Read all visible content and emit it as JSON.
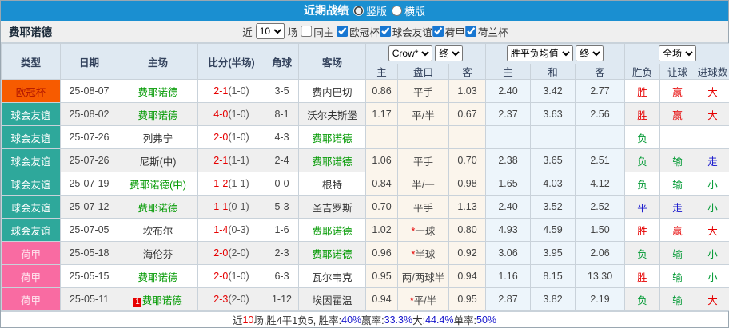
{
  "title_bar": {
    "title": "近期战绩",
    "vertical_label": "竖版",
    "horizontal_label": "横版"
  },
  "controls": {
    "team": "费耶诺德",
    "near_label": "近",
    "games_value": "10",
    "games_label": "场",
    "same_home_label": "同主",
    "league_filters": [
      "欧冠杯",
      "球会友谊",
      "荷甲",
      "荷兰杯"
    ]
  },
  "header": {
    "main_cols": [
      "类型",
      "日期",
      "主场",
      "比分(半场)",
      "角球",
      "客场"
    ],
    "asian_company_select": "Crow*",
    "asian_time_select": "终",
    "europe_company_select": "胜平负均值",
    "europe_time_select": "终",
    "scope_select": "全场",
    "asian_sub": [
      "主",
      "盘口",
      "客"
    ],
    "europe_sub": [
      "主",
      "和",
      "客"
    ],
    "result_sub": [
      "胜负",
      "让球",
      "进球数"
    ]
  },
  "league_colors": {
    "cl": "#f75b00",
    "friendly": "#2ea89b",
    "eredivisie": "#f96ba2"
  },
  "result_colors": {
    "red": "#e60000",
    "green": "#009933",
    "blue": "#1414cc"
  },
  "rows": [
    {
      "league": "欧冠杯",
      "league_type": "cl",
      "date": "25-08-07",
      "home": "费耶诺德",
      "home_highlight": true,
      "home_rank": "",
      "score": "2-1",
      "half": "(1-0)",
      "corners": "3-5",
      "away": "费内巴切",
      "away_highlight": false,
      "asian_home": "0.86",
      "handicap": "平手",
      "handicap_star": false,
      "asian_away": "1.03",
      "eu_home": "2.40",
      "eu_draw": "3.42",
      "eu_away": "2.77",
      "wdl": "胜",
      "wdl_color": "red",
      "hcp": "赢",
      "hcp_color": "red",
      "goal": "大",
      "goal_color": "red"
    },
    {
      "league": "球会友谊",
      "league_type": "friendly",
      "date": "25-08-02",
      "home": "费耶诺德",
      "home_highlight": true,
      "home_rank": "",
      "score": "4-0",
      "half": "(1-0)",
      "corners": "8-1",
      "away": "沃尔夫斯堡",
      "away_highlight": false,
      "asian_home": "1.17",
      "handicap": "平/半",
      "handicap_star": false,
      "asian_away": "0.67",
      "eu_home": "2.37",
      "eu_draw": "3.63",
      "eu_away": "2.56",
      "wdl": "胜",
      "wdl_color": "red",
      "hcp": "赢",
      "hcp_color": "red",
      "goal": "大",
      "goal_color": "red"
    },
    {
      "league": "球会友谊",
      "league_type": "friendly",
      "date": "25-07-26",
      "home": "列弗宁",
      "home_highlight": false,
      "home_rank": "",
      "score": "2-0",
      "half": "(1-0)",
      "corners": "4-3",
      "away": "费耶诺德",
      "away_highlight": true,
      "asian_home": "",
      "handicap": "",
      "handicap_star": false,
      "asian_away": "",
      "eu_home": "",
      "eu_draw": "",
      "eu_away": "",
      "wdl": "负",
      "wdl_color": "green",
      "hcp": "",
      "hcp_color": "black",
      "goal": "",
      "goal_color": "black"
    },
    {
      "league": "球会友谊",
      "league_type": "friendly",
      "date": "25-07-26",
      "home": "尼斯(中)",
      "home_highlight": false,
      "home_rank": "",
      "score": "2-1",
      "half": "(1-1)",
      "corners": "2-4",
      "away": "费耶诺德",
      "away_highlight": true,
      "asian_home": "1.06",
      "handicap": "平手",
      "handicap_star": false,
      "asian_away": "0.70",
      "eu_home": "2.38",
      "eu_draw": "3.65",
      "eu_away": "2.51",
      "wdl": "负",
      "wdl_color": "green",
      "hcp": "输",
      "hcp_color": "green",
      "goal": "走",
      "goal_color": "blue"
    },
    {
      "league": "球会友谊",
      "league_type": "friendly",
      "date": "25-07-19",
      "home": "费耶诺德(中)",
      "home_highlight": true,
      "home_rank": "",
      "score": "1-2",
      "half": "(1-1)",
      "corners": "0-0",
      "away": "根特",
      "away_highlight": false,
      "asian_home": "0.84",
      "handicap": "半/一",
      "handicap_star": false,
      "asian_away": "0.98",
      "eu_home": "1.65",
      "eu_draw": "4.03",
      "eu_away": "4.12",
      "wdl": "负",
      "wdl_color": "green",
      "hcp": "输",
      "hcp_color": "green",
      "goal": "小",
      "goal_color": "green"
    },
    {
      "league": "球会友谊",
      "league_type": "friendly",
      "date": "25-07-12",
      "home": "费耶诺德",
      "home_highlight": true,
      "home_rank": "",
      "score": "1-1",
      "half": "(0-1)",
      "corners": "5-3",
      "away": "圣吉罗斯",
      "away_highlight": false,
      "asian_home": "0.70",
      "handicap": "平手",
      "handicap_star": false,
      "asian_away": "1.13",
      "eu_home": "2.40",
      "eu_draw": "3.52",
      "eu_away": "2.52",
      "wdl": "平",
      "wdl_color": "blue",
      "hcp": "走",
      "hcp_color": "blue",
      "goal": "小",
      "goal_color": "green"
    },
    {
      "league": "球会友谊",
      "league_type": "friendly",
      "date": "25-07-05",
      "home": "坎布尔",
      "home_highlight": false,
      "home_rank": "",
      "score": "1-4",
      "half": "(0-3)",
      "corners": "1-6",
      "away": "费耶诺德",
      "away_highlight": true,
      "asian_home": "1.02",
      "handicap": "一球",
      "handicap_star": true,
      "asian_away": "0.80",
      "eu_home": "4.93",
      "eu_draw": "4.59",
      "eu_away": "1.50",
      "wdl": "胜",
      "wdl_color": "red",
      "hcp": "赢",
      "hcp_color": "red",
      "goal": "大",
      "goal_color": "red"
    },
    {
      "league": "荷甲",
      "league_type": "eredivisie",
      "date": "25-05-18",
      "home": "海伦芬",
      "home_highlight": false,
      "home_rank": "",
      "score": "2-0",
      "half": "(2-0)",
      "corners": "2-3",
      "away": "费耶诺德",
      "away_highlight": true,
      "asian_home": "0.96",
      "handicap": "半球",
      "handicap_star": true,
      "asian_away": "0.92",
      "eu_home": "3.06",
      "eu_draw": "3.95",
      "eu_away": "2.06",
      "wdl": "负",
      "wdl_color": "green",
      "hcp": "输",
      "hcp_color": "green",
      "goal": "小",
      "goal_color": "green"
    },
    {
      "league": "荷甲",
      "league_type": "eredivisie",
      "date": "25-05-15",
      "home": "费耶诺德",
      "home_highlight": true,
      "home_rank": "",
      "score": "2-0",
      "half": "(1-0)",
      "corners": "6-3",
      "away": "瓦尔韦克",
      "away_highlight": false,
      "asian_home": "0.95",
      "handicap": "两/两球半",
      "handicap_star": false,
      "asian_away": "0.94",
      "eu_home": "1.16",
      "eu_draw": "8.15",
      "eu_away": "13.30",
      "wdl": "胜",
      "wdl_color": "red",
      "hcp": "输",
      "hcp_color": "green",
      "goal": "小",
      "goal_color": "green"
    },
    {
      "league": "荷甲",
      "league_type": "eredivisie",
      "date": "25-05-11",
      "home": "费耶诺德",
      "home_highlight": true,
      "home_rank": "1",
      "score": "2-3",
      "half": "(2-0)",
      "corners": "1-12",
      "away": "埃因霍温",
      "away_highlight": false,
      "asian_home": "0.94",
      "handicap": "平/半",
      "handicap_star": true,
      "asian_away": "0.95",
      "eu_home": "2.87",
      "eu_draw": "3.82",
      "eu_away": "2.19",
      "wdl": "负",
      "wdl_color": "green",
      "hcp": "输",
      "hcp_color": "green",
      "goal": "大",
      "goal_color": "red"
    }
  ],
  "footer_segments": [
    {
      "text": "近",
      "color": "black"
    },
    {
      "text": "10",
      "color": "red"
    },
    {
      "text": "场,胜4平1负5, 胜率:",
      "color": "black"
    },
    {
      "text": "40%",
      "color": "blue"
    },
    {
      "text": " 赢率:",
      "color": "black"
    },
    {
      "text": "33.3%",
      "color": "blue"
    },
    {
      "text": " 大:",
      "color": "black"
    },
    {
      "text": "44.4%",
      "color": "blue"
    },
    {
      "text": " 单率:",
      "color": "black"
    },
    {
      "text": "50%",
      "color": "blue"
    }
  ]
}
